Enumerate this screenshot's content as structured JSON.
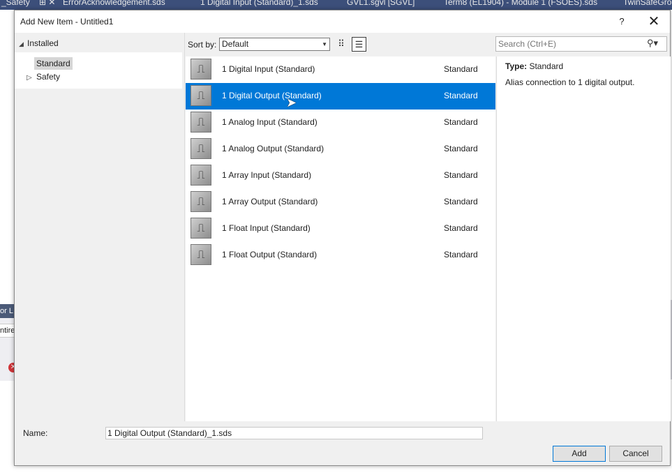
{
  "background": {
    "tabs": [
      "_Safety",
      "ErrorAcknowledgement.sds",
      "1 Digital Input (Standard)_1.sds",
      "GVL1.sgvl [SGVL]",
      "Term8 (EL1904) - Module 1 (FSOES).sds",
      "TwinSafeGroup"
    ],
    "side_panel_title": "or L",
    "side_panel_row": "ntire"
  },
  "dialog": {
    "title": "Add New Item - Untitled1",
    "help_label": "?",
    "close_label": "✕"
  },
  "tree": {
    "root_label": "Installed",
    "items": [
      {
        "label": "Standard"
      },
      {
        "label": "Safety"
      }
    ]
  },
  "toolbar": {
    "sort_label": "Sort by:",
    "sort_value": "Default"
  },
  "search": {
    "placeholder": "Search (Ctrl+E)"
  },
  "items": [
    {
      "name": "1 Digital Input (Standard)",
      "category": "Standard"
    },
    {
      "name": "1 Digital Output (Standard)",
      "category": "Standard"
    },
    {
      "name": "1 Analog Input (Standard)",
      "category": "Standard"
    },
    {
      "name": "1 Analog Output (Standard)",
      "category": "Standard"
    },
    {
      "name": "1 Array Input (Standard)",
      "category": "Standard"
    },
    {
      "name": "1 Array Output (Standard)",
      "category": "Standard"
    },
    {
      "name": "1 Float Input (Standard)",
      "category": "Standard"
    },
    {
      "name": "1 Float Output (Standard)",
      "category": "Standard"
    }
  ],
  "selected_index": 1,
  "info": {
    "type_label": "Type:",
    "type_value": "Standard",
    "description": "Alias connection to 1 digital output."
  },
  "footer": {
    "name_label": "Name:",
    "name_value": "1 Digital Output (Standard)_1.sds",
    "add_label": "Add",
    "cancel_label": "Cancel"
  },
  "colors": {
    "selection": "#0078d7",
    "dialog_bg": "#f0f0f0",
    "ide_tab_bg": "#3c4f7a"
  }
}
